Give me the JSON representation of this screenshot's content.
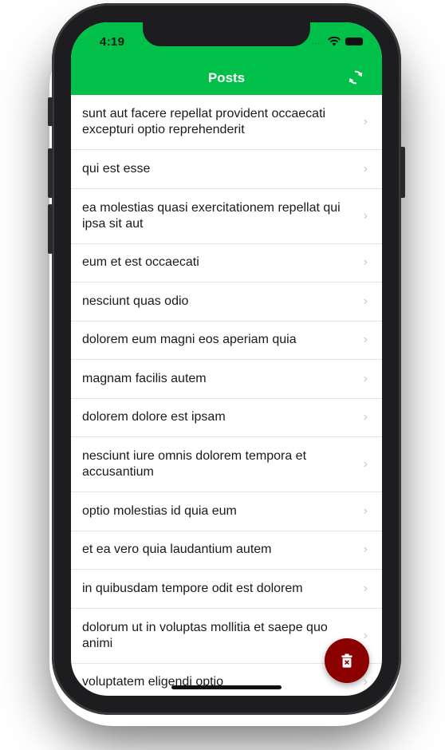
{
  "status_bar": {
    "time": "4:19",
    "signal_dots": "....",
    "wifi_icon": "wifi-icon",
    "battery_icon": "battery-icon"
  },
  "header": {
    "title": "Posts",
    "refresh_icon": "refresh-icon"
  },
  "posts": [
    {
      "title": "sunt aut facere repellat provident occaecati excepturi optio reprehenderit"
    },
    {
      "title": "qui est esse"
    },
    {
      "title": "ea molestias quasi exercitationem repellat qui ipsa sit aut"
    },
    {
      "title": "eum et est occaecati"
    },
    {
      "title": "nesciunt quas odio"
    },
    {
      "title": "dolorem eum magni eos aperiam quia"
    },
    {
      "title": "magnam facilis autem"
    },
    {
      "title": "dolorem dolore est ipsam"
    },
    {
      "title": "nesciunt iure omnis dolorem tempora et accusantium"
    },
    {
      "title": "optio molestias id quia eum"
    },
    {
      "title": "et ea vero quia laudantium autem"
    },
    {
      "title": "in quibusdam tempore odit est dolorem"
    },
    {
      "title": "dolorum ut in voluptas mollitia et saepe quo animi"
    },
    {
      "title": "voluptatem eligendi optio"
    }
  ],
  "chevron": "›",
  "fab": {
    "icon": "trash-icon"
  },
  "colors": {
    "header": "#00c04a",
    "fab": "#8b0000",
    "separator": "#e6e6e6"
  }
}
